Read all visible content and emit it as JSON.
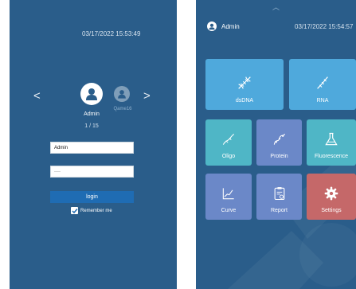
{
  "login": {
    "timestamp": "03/17/2022 15:53:49",
    "nav_prev": "<",
    "nav_next": ">",
    "current_user": "Admin",
    "other_user": "Qame16",
    "user_counter": "1 / 15",
    "username_value": "Admin",
    "password_value": "····",
    "login_label": "login",
    "remember_label": "Remember me",
    "remember_checked": true
  },
  "home": {
    "chevron": "︿",
    "user_name": "Admin",
    "timestamp": "03/17/2022 15:54:57",
    "tiles": [
      {
        "label": "dsDNA",
        "icon": "dna-icon",
        "color": "#4fa9dc"
      },
      {
        "label": "RNA",
        "icon": "rna-icon",
        "color": "#4fa9dc"
      },
      {
        "label": "Oligo",
        "icon": "oligo-icon",
        "color": "#4fb6c6"
      },
      {
        "label": "Protein",
        "icon": "protein-icon",
        "color": "#6b88c8"
      },
      {
        "label": "Fluorescence",
        "icon": "flask-icon",
        "color": "#4fb6c6"
      },
      {
        "label": "Curve",
        "icon": "curve-icon",
        "color": "#6b88c8"
      },
      {
        "label": "Report",
        "icon": "report-icon",
        "color": "#6b88c8"
      },
      {
        "label": "Settings",
        "icon": "gear-icon",
        "color": "#c56869"
      }
    ]
  },
  "colors": {
    "screen_bg": "#2a5d8a",
    "login_button": "#1f6cb3"
  }
}
